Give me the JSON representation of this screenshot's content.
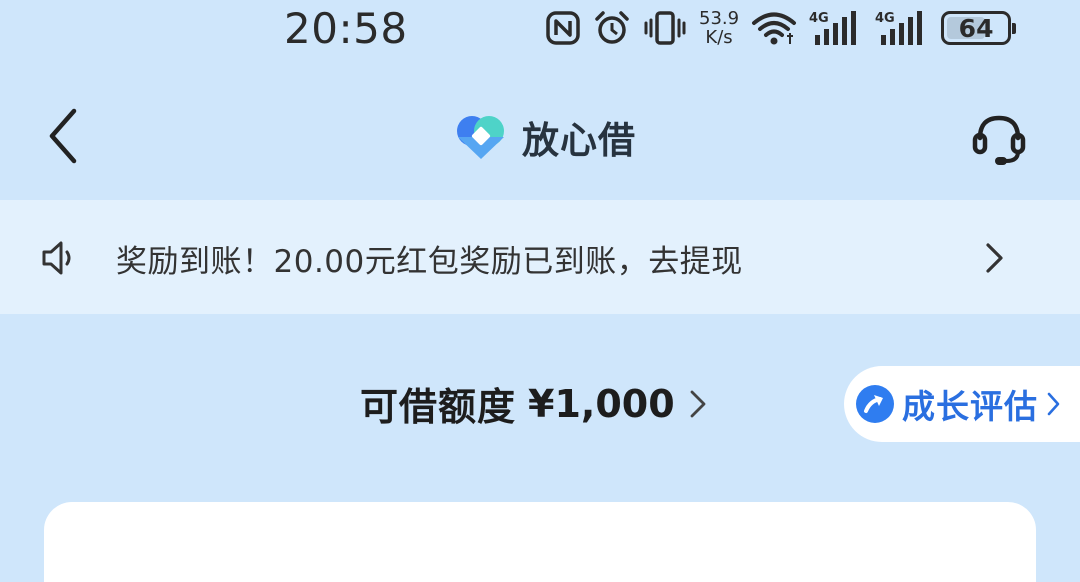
{
  "status_bar": {
    "time": "20:58",
    "net_speed_value": "53.9",
    "net_speed_unit": "K/s",
    "signal_1_label": "4G",
    "signal_2_label": "4G",
    "battery": "64",
    "icons": [
      "nfc-icon",
      "alarm-icon",
      "vibrate-icon",
      "wifi-icon",
      "cellular-signal-icon",
      "cellular-signal-icon",
      "battery-icon"
    ]
  },
  "nav": {
    "title": "放心借",
    "back_icon": "chevron-left-icon",
    "support_icon": "headset-icon"
  },
  "notice": {
    "text": "奖励到账！20.00元红包奖励已到账，去提现",
    "icon": "speaker-icon"
  },
  "credit": {
    "label": "可借额度",
    "amount": "¥1,000"
  },
  "growth": {
    "label": "成长评估",
    "icon": "arrow-up-circle-icon"
  },
  "colors": {
    "background": "#cfe6fb",
    "notice_bg": "#e3f1fd",
    "accent_blue": "#2a6fe0",
    "card": "#ffffff"
  }
}
